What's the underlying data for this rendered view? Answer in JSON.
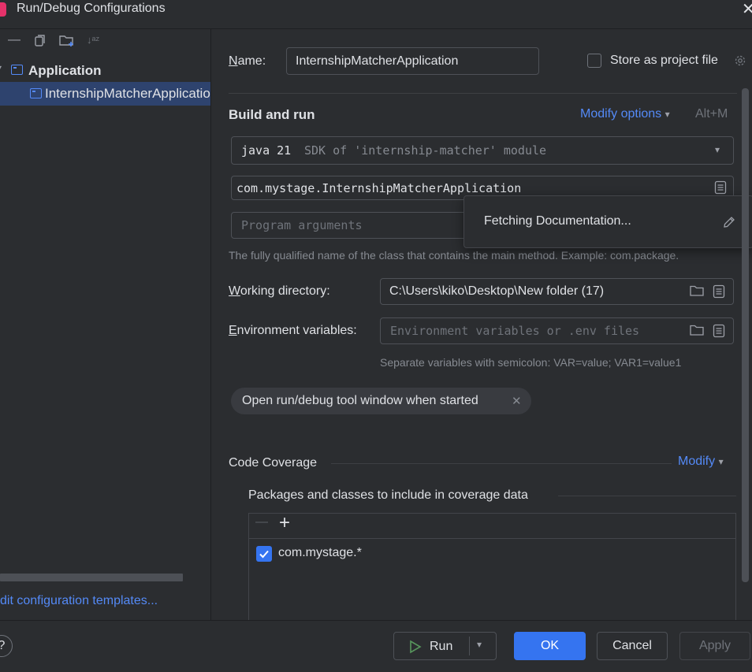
{
  "window": {
    "title": "Run/Debug Configurations",
    "close_glyph": "✕"
  },
  "toolbar": {
    "remove": "—",
    "copy": "⧉",
    "sort": "↓ᵃᶻ"
  },
  "tree": {
    "expand_glyph": "▾",
    "group_label": "Application",
    "item_label": "InternshipMatcherApplicatio"
  },
  "left_footer": {
    "templates_link": "dit configuration templates..."
  },
  "form": {
    "name_label": "Name:",
    "name_value": "InternshipMatcherApplication",
    "store_label": "Store as project file",
    "build_section": "Build and run",
    "modify_options": "Modify options",
    "modify_shortcut": "Alt+M",
    "sdk_java": "java 21",
    "sdk_desc": "SDK of 'internship-matcher' module",
    "main_class": "com.mystage.InternshipMatcherApplication",
    "program_args_placeholder": "Program arguments",
    "main_class_hint": "The fully qualified name of the class that contains the main method. Example: com.package.",
    "working_dir_label": "Working directory:",
    "working_dir_value": "C:\\Users\\kiko\\Desktop\\New folder (17)",
    "env_label": "Environment variables:",
    "env_placeholder": "Environment variables or .env files",
    "env_hint": "Separate variables with semicolon: VAR=value; VAR1=value1",
    "chip_label": "Open run/debug tool window when started",
    "coverage_section": "Code Coverage",
    "coverage_modify": "Modify",
    "coverage_sub": "Packages and classes to include in coverage data",
    "coverage_remove": "—",
    "coverage_add": "+",
    "coverage_item": "com.mystage.*",
    "coverage_item_checked": true
  },
  "popup": {
    "text": "Fetching Documentation..."
  },
  "buttons": {
    "help": "?",
    "run": "Run",
    "ok": "OK",
    "cancel": "Cancel",
    "apply": "Apply"
  },
  "colors": {
    "accent": "#3574f0",
    "link": "#548af7",
    "background": "#2b2d30",
    "selection": "#2e436e"
  },
  "icons": [
    "minus-icon",
    "copy-icon",
    "new-folder-icon",
    "sort-icon",
    "config-icon",
    "gear-icon",
    "chevron-down-icon",
    "document-icon",
    "pencil-icon",
    "folder-icon",
    "close-icon",
    "plus-icon",
    "check-icon",
    "play-icon",
    "help-icon"
  ]
}
